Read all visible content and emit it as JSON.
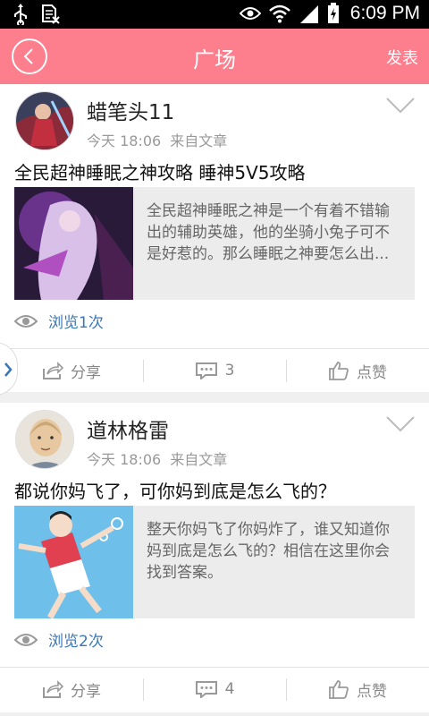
{
  "statusbar": {
    "time": "6:09 PM",
    "icons": [
      "usb-icon",
      "sim-off-icon",
      "eye-icon",
      "wifi-icon",
      "signal-icon",
      "battery-charging-icon"
    ]
  },
  "header": {
    "title": "广场",
    "publish_label": "发表",
    "background_color": "#fd7e8c"
  },
  "posts": [
    {
      "author": "蜡笔头11",
      "time": "今天 18:06",
      "source": "来自文章",
      "title": "全民超神睡眠之神攻略 睡神5V5攻略",
      "excerpt": "全民超神睡眠之神是一个有着不错输出的辅助英雄，他的坐骑小兔子可不是好惹的。那么睡眠之神要怎么出...",
      "views": "浏览1次",
      "share_label": "分享",
      "comment_count": "3",
      "like_label": "点赞"
    },
    {
      "author": "道林格雷",
      "time": "今天 18:06",
      "source": "来自文章",
      "title": "都说你妈飞了，可你妈到底是怎么飞的？",
      "excerpt": "整天你妈飞了你妈炸了，谁又知道你妈到底是怎么飞的？相信在这里你会找到答案。",
      "views": "浏览2次",
      "share_label": "分享",
      "comment_count": "4",
      "like_label": "点赞"
    }
  ],
  "accent_color": "#3a77b5"
}
